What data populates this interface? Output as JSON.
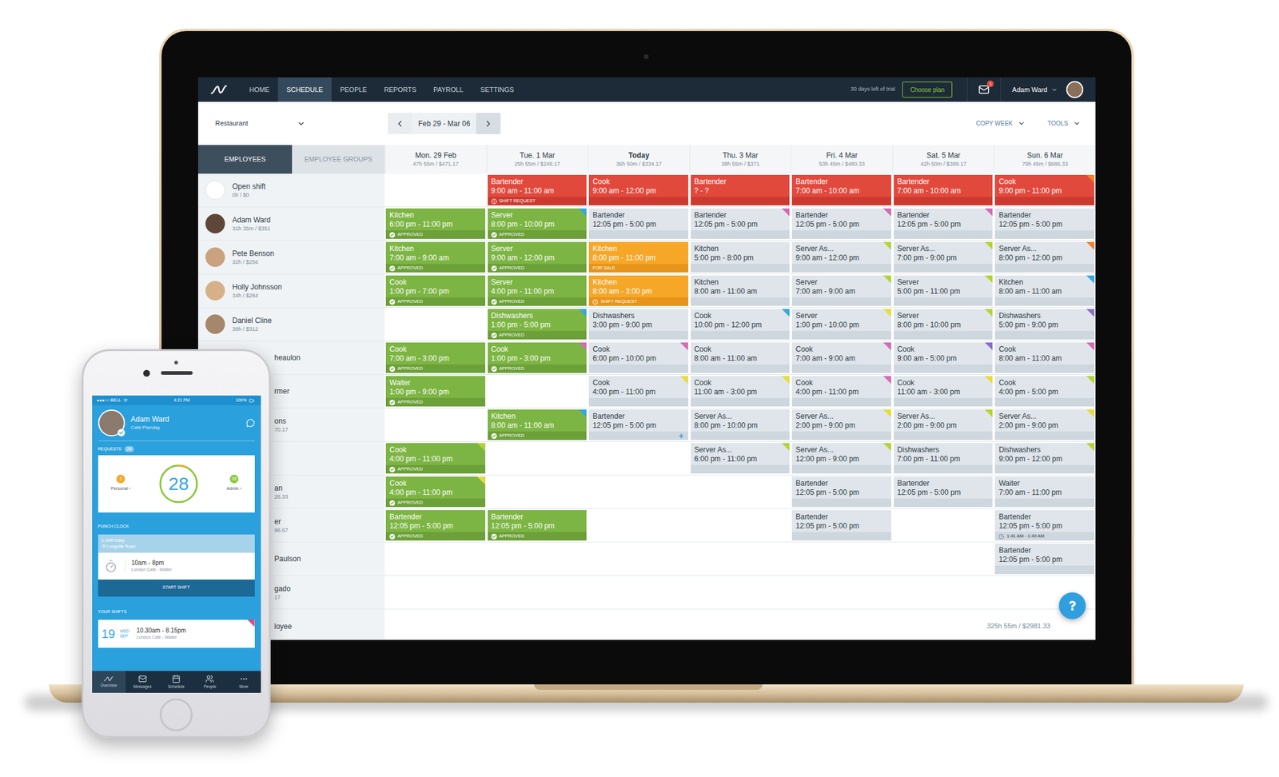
{
  "nav": {
    "items": [
      {
        "label": "HOME",
        "selected": false
      },
      {
        "label": "SCHEDULE",
        "selected": true
      },
      {
        "label": "PEOPLE",
        "selected": false
      },
      {
        "label": "REPORTS",
        "selected": false
      },
      {
        "label": "PAYROLL",
        "selected": false
      },
      {
        "label": "SETTINGS",
        "selected": false
      }
    ],
    "trial": "30 days left of trial",
    "plan_button": "Choose plan",
    "mail_badge": "1",
    "user": "Adam Ward"
  },
  "toolbar": {
    "location": "Restaurant",
    "date_range": "Feb 29 - Mar 06",
    "copy_week": "COPY WEEK",
    "tools": "TOOLS"
  },
  "tabs": [
    {
      "label": "EMPLOYEES",
      "selected": true
    },
    {
      "label": "EMPLOYEE GROUPS",
      "selected": false
    }
  ],
  "days": [
    {
      "label": "Mon. 29 Feb",
      "summary": "47h 55m / $471.17",
      "today": false
    },
    {
      "label": "Tue. 1 Mar",
      "summary": "25h 55m / $249.17",
      "today": false
    },
    {
      "label": "Today",
      "summary": "36h 50m / $334.17",
      "today": true
    },
    {
      "label": "Thu. 3 Mar",
      "summary": "38h 55m / $371",
      "today": false
    },
    {
      "label": "Fri. 4 Mar",
      "summary": "53h 45m / $480.33",
      "today": false
    },
    {
      "label": "Sat. 5 Mar",
      "summary": "42h 50m / $389.17",
      "today": false
    },
    {
      "label": "Sun. 6 Mar",
      "summary": "79h 45m / $686.33",
      "today": false
    }
  ],
  "rows": [
    {
      "name": "Open shift",
      "hours": "0h / $0",
      "kind": "open",
      "shifts": [
        null,
        {
          "role": "Bartender",
          "time": "9:00 am - 11:00 am",
          "kind": "open",
          "status": "SHIFT REQUEST",
          "status_kind": "request"
        },
        {
          "role": "Cook",
          "time": "9:00 am - 12:00 pm",
          "kind": "open"
        },
        {
          "role": "Bartender",
          "time": "? - ?",
          "kind": "open"
        },
        {
          "role": "Bartender",
          "time": "7:00 am - 10:00 am",
          "kind": "open"
        },
        {
          "role": "Bartender",
          "time": "7:00 am - 10:00 am",
          "kind": "open"
        },
        {
          "role": "Cook",
          "time": "9:00 pm - 11:00 pm",
          "kind": "open",
          "tag": "#f07f2e"
        }
      ]
    },
    {
      "name": "Adam Ward",
      "hours": "31h 35m / $351",
      "kind": "full",
      "shifts": [
        {
          "role": "Kitchen",
          "time": "6:00 pm - 11:00 pm",
          "kind": "approved",
          "status": "APPROVED",
          "status_kind": "approved"
        },
        {
          "role": "Server",
          "time": "8:00 pm - 10:00 pm",
          "kind": "approved",
          "status": "APPROVED",
          "status_kind": "approved",
          "tag": "#35a8e0"
        },
        {
          "role": "Bartender",
          "time": "12:05 pm - 5:00 pm",
          "kind": "draft"
        },
        {
          "role": "Bartender",
          "time": "12:05 pm - 5:00 pm",
          "kind": "draft",
          "tag": "#d66bb5"
        },
        {
          "role": "Bartender",
          "time": "12:05 pm - 5:00 pm",
          "kind": "draft",
          "tag": "#d66bb5"
        },
        {
          "role": "Bartender",
          "time": "12:05 pm - 5:00 pm",
          "kind": "draft",
          "tag": "#d66bb5"
        },
        {
          "role": "Bartender",
          "time": "12:05 pm - 5:00 pm",
          "kind": "draft"
        }
      ]
    },
    {
      "name": "Pete Benson",
      "hours": "32h / $256",
      "kind": "full",
      "shifts": [
        {
          "role": "Kitchen",
          "time": "7:00 am - 9:00 am",
          "kind": "approved",
          "status": "APPROVED",
          "status_kind": "approved"
        },
        {
          "role": "Server",
          "time": "9:00 am - 12:00 pm",
          "kind": "approved",
          "status": "APPROVED",
          "status_kind": "approved"
        },
        {
          "role": "Kitchen",
          "time": "8:00 pm - 11:00 pm",
          "kind": "pending",
          "status": "FOR SALE",
          "status_kind": "sale"
        },
        {
          "role": "Kitchen",
          "time": "5:00 pm - 8:00 pm",
          "kind": "draft"
        },
        {
          "role": "Server As...",
          "time": "9:00 am - 12:00 pm",
          "kind": "draft",
          "tag": "#b5d334"
        },
        {
          "role": "Server As...",
          "time": "7:00 pm - 9:00 pm",
          "kind": "draft",
          "tag": "#b5d334"
        },
        {
          "role": "Server As...",
          "time": "8:00 pm - 12:00 pm",
          "kind": "draft",
          "tag": "#f07f2e"
        }
      ]
    },
    {
      "name": "Holly Johnsson",
      "hours": "34h / $284",
      "kind": "full",
      "shifts": [
        {
          "role": "Cook",
          "time": "1:00 pm - 7:00 pm",
          "kind": "approved",
          "status": "APPROVED",
          "status_kind": "approved"
        },
        {
          "role": "Server",
          "time": "4:00 pm - 11:00 pm",
          "kind": "approved",
          "status": "APPROVED",
          "status_kind": "approved"
        },
        {
          "role": "Kitchen",
          "time": "8:00 am - 3:00 pm",
          "kind": "pending",
          "status": "SHIFT REQUEST",
          "status_kind": "request"
        },
        {
          "role": "Kitchen",
          "time": "8:00 am - 11:00 am",
          "kind": "draft"
        },
        {
          "role": "Server",
          "time": "7:00 am - 9:00 am",
          "kind": "draft",
          "tag": "#b5d334"
        },
        {
          "role": "Server",
          "time": "5:00 pm - 11:00 pm",
          "kind": "draft",
          "tag": "#b5d334"
        },
        {
          "role": "Kitchen",
          "time": "8:00 am - 11:00 am",
          "kind": "draft",
          "tag": "#35a8e0"
        }
      ]
    },
    {
      "name": "Daniel Cline",
      "hours": "39h / $312",
      "kind": "full",
      "shifts": [
        null,
        {
          "role": "Dishwashers",
          "time": "1:00 pm - 5:00 pm",
          "kind": "approved",
          "status": "APPROVED",
          "status_kind": "approved",
          "tag": "#35a8e0"
        },
        {
          "role": "Dishwashers",
          "time": "3:00 pm - 9:00 pm",
          "kind": "draft"
        },
        {
          "role": "Cook",
          "time": "10:00 pm - 12:00 pm",
          "kind": "draft",
          "tag": "#35a8e0"
        },
        {
          "role": "Server",
          "time": "1:00 pm - 10:00 pm",
          "kind": "draft",
          "tag": "#e4dd3b"
        },
        {
          "role": "Server",
          "time": "8:00 pm - 10:00 pm",
          "kind": "draft",
          "tag": "#b5d334"
        },
        {
          "role": "Dishwashers",
          "time": "5:00 pm - 9:00 pm",
          "kind": "draft",
          "tag": "#8a6fc7"
        }
      ]
    },
    {
      "name": "heaulon",
      "kind": "covered",
      "shifts": [
        {
          "role": "Cook",
          "time": "7:00 am - 3:00 pm",
          "kind": "approved",
          "status": "APPROVED",
          "status_kind": "approved"
        },
        {
          "role": "Cook",
          "time": "1:00 pm - 3:00 pm",
          "kind": "approved",
          "status": "APPROVED",
          "status_kind": "approved",
          "tag": "#d66bb5"
        },
        {
          "role": "Cook",
          "time": "6:00 pm - 10:00 pm",
          "kind": "draft",
          "tag": "#d66bb5"
        },
        {
          "role": "Cook",
          "time": "8:00 am - 11:00 am",
          "kind": "draft"
        },
        {
          "role": "Cook",
          "time": "7:00 am - 9:00 am",
          "kind": "draft",
          "tag": "#d66bb5"
        },
        {
          "role": "Cook",
          "time": "9:00 am - 5:00 pm",
          "kind": "draft",
          "tag": "#8a6fc7"
        },
        {
          "role": "Cook",
          "time": "8:00 am - 11:00 am",
          "kind": "draft",
          "tag": "#d66bb5"
        }
      ]
    },
    {
      "name": "rmer",
      "kind": "covered",
      "shifts": [
        {
          "role": "Waiter",
          "time": "1:00 pm - 9:00 pm",
          "kind": "approved",
          "status": "APPROVED",
          "status_kind": "approved"
        },
        null,
        {
          "role": "Cook",
          "time": "4:00 pm - 11:00 pm",
          "kind": "draft",
          "tag": "#e4dd3b"
        },
        {
          "role": "Cook",
          "time": "11:00 am - 3:00 pm",
          "kind": "draft",
          "tag": "#e4dd3b"
        },
        {
          "role": "Cook",
          "time": "4:00 pm - 11:00 pm",
          "kind": "draft",
          "tag": "#d66bb5"
        },
        {
          "role": "Cook",
          "time": "11:00 am - 3:00 pm",
          "kind": "draft",
          "tag": "#e4dd3b"
        },
        {
          "role": "Cook",
          "time": "4:00 pm - 5:00 pm",
          "kind": "draft",
          "tag": "#b5d334"
        }
      ]
    },
    {
      "name": "ons",
      "hours": "70.17",
      "kind": "covered",
      "shifts": [
        null,
        {
          "role": "Kitchen",
          "time": "8:00 am - 11:00 am",
          "kind": "approved",
          "status": "APPROVED",
          "status_kind": "approved",
          "tag": "#35a8e0"
        },
        {
          "role": "Bartender",
          "time": "12:05 pm - 5:00 pm",
          "kind": "draft",
          "add_icon": true
        },
        {
          "role": "Server As...",
          "time": "8:00 pm - 10:00 pm",
          "kind": "draft"
        },
        {
          "role": "Server As...",
          "time": "2:00 pm - 9:00 pm",
          "kind": "draft",
          "tag": "#e4dd3b"
        },
        {
          "role": "Server As...",
          "time": "2:00 pm - 9:00 pm",
          "kind": "draft",
          "tag": "#b5d334"
        },
        {
          "role": "Server As...",
          "time": "2:00 pm - 9:00 pm",
          "kind": "draft",
          "tag": "#e4dd3b"
        }
      ]
    },
    {
      "kind": "covered",
      "shifts": [
        {
          "role": "Cook",
          "time": "4:00 pm - 11:00 pm",
          "kind": "approved",
          "status": "APPROVED",
          "status_kind": "approved",
          "tag": "#b5d334"
        },
        null,
        null,
        {
          "role": "Server As...",
          "time": "6:00 pm - 11:00 pm",
          "kind": "draft",
          "tag": "#b5d334"
        },
        {
          "role": "Server As...",
          "time": "12:00 pm - 9:00 pm",
          "kind": "draft",
          "tag": "#b5d334"
        },
        {
          "role": "Dishwashers",
          "time": "7:00 pm - 11:00 pm",
          "kind": "draft"
        },
        {
          "role": "Dishwashers",
          "time": "9:00 pm - 12:00 pm",
          "kind": "draft",
          "tag": "#b5d334"
        }
      ]
    },
    {
      "name": "an",
      "hours": "26.33",
      "kind": "covered",
      "shifts": [
        {
          "role": "Cook",
          "time": "4:00 pm - 11:00 pm",
          "kind": "approved",
          "status": "APPROVED",
          "status_kind": "approved",
          "tag": "#e4dd3b"
        },
        null,
        null,
        null,
        {
          "role": "Bartender",
          "time": "12:05 pm - 5:00 pm",
          "kind": "draft"
        },
        {
          "role": "Bartender",
          "time": "12:05 pm - 5:00 pm",
          "kind": "draft"
        },
        {
          "role": "Waiter",
          "time": "7:00 am - 11:00 pm",
          "kind": "draft"
        }
      ]
    },
    {
      "name": "er",
      "hours": "96.67",
      "kind": "covered",
      "shifts": [
        {
          "role": "Bartender",
          "time": "12:05 pm - 5:00 pm",
          "kind": "approved",
          "status": "APPROVED",
          "status_kind": "approved"
        },
        {
          "role": "Bartender",
          "time": "12:05 pm - 5:00 pm",
          "kind": "approved",
          "status": "APPROVED",
          "status_kind": "approved"
        },
        null,
        null,
        {
          "role": "Bartender",
          "time": "12:05 pm - 5:00 pm",
          "kind": "draft"
        },
        null,
        {
          "role": "Bartender",
          "time": "12:05 pm - 5:00 pm",
          "kind": "draft",
          "status": "1:41 AM - 1:49 AM",
          "status_kind": "clock"
        }
      ]
    },
    {
      "name": "Paulson",
      "kind": "covered",
      "shifts": [
        null,
        null,
        null,
        null,
        null,
        null,
        {
          "role": "Bartender",
          "time": "12:05 pm - 5:00 pm",
          "kind": "draft"
        }
      ]
    },
    {
      "name": "gado",
      "hours": "17",
      "kind": "covered",
      "shifts": [
        null,
        null,
        null,
        null,
        null,
        null,
        null
      ]
    }
  ],
  "footer": {
    "label": "loyee",
    "total": "325h 55m / $2981.33"
  },
  "phone": {
    "status_bar": {
      "carrier": "●●●○○ BELL",
      "time": "4:21 PM",
      "battery": "100%"
    },
    "profile": {
      "name": "Adam Ward",
      "workplace": "Café Planday"
    },
    "requests": {
      "label": "REQUESTS",
      "badge": "28",
      "total": "28",
      "arrow": "›",
      "personal": {
        "label": "Personal",
        "count": "2"
      },
      "admin": {
        "label": "Admin",
        "count": "26"
      }
    },
    "punch_clock": {
      "label": "PUNCH CLOCK",
      "shifts_today": "1 shift today",
      "address": "Longville Road",
      "time": "10am - 8pm",
      "place": "London Café - Waiter",
      "button": "START SHIFT"
    },
    "your_shifts": {
      "label": "YOUR SHIFTS",
      "items": [
        {
          "day": "19",
          "weekday": "WED",
          "month": "SEP",
          "time": "10.30am - 8.15pm",
          "place": "London Café - Waiter",
          "tag": "#e8457a"
        }
      ]
    },
    "tabs": [
      {
        "label": "Overview",
        "selected": true
      },
      {
        "label": "Messages",
        "selected": false
      },
      {
        "label": "Schedule",
        "selected": false
      },
      {
        "label": "People",
        "selected": false
      },
      {
        "label": "More",
        "selected": false
      }
    ]
  }
}
